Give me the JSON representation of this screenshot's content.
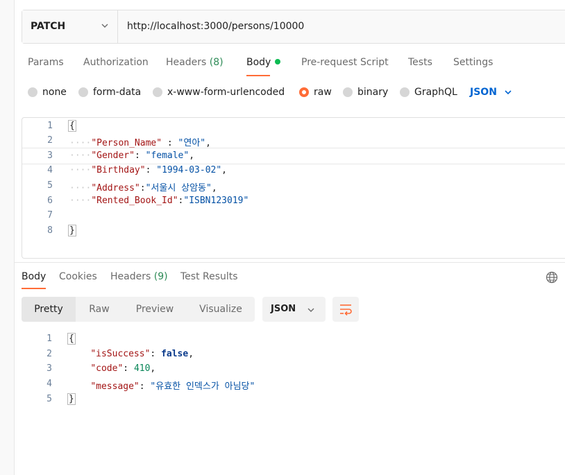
{
  "request": {
    "method": "PATCH",
    "url": "http://localhost:3000/persons/10000",
    "tabs": [
      {
        "label": "Params"
      },
      {
        "label": "Authorization"
      },
      {
        "label": "Headers",
        "count": "(8)"
      },
      {
        "label": "Body"
      },
      {
        "label": "Pre-request Script"
      },
      {
        "label": "Tests"
      },
      {
        "label": "Settings"
      }
    ],
    "body_types": [
      "none",
      "form-data",
      "x-www-form-urlencoded",
      "raw",
      "binary",
      "GraphQL"
    ],
    "selected_body_type": "raw",
    "format": "JSON",
    "line_numbers": [
      "1",
      "2",
      "3",
      "4",
      "5",
      "6",
      "7",
      "8"
    ],
    "body": {
      "open": "{",
      "close": "}",
      "fields": [
        {
          "key": "\"Person_Name\"",
          "sep": " : ",
          "value": "\"연아\"",
          "trail": ","
        },
        {
          "key": "\"Gender\"",
          "sep": ": ",
          "value": "\"female\"",
          "trail": ","
        },
        {
          "key": "\"Birthday\"",
          "sep": ": ",
          "value": "\"1994-03-02\"",
          "trail": ","
        },
        {
          "key": "\"Address\"",
          "sep": ":",
          "value": "\"서울시 상암동\"",
          "trail": ","
        },
        {
          "key": "\"Rented_Book_Id\"",
          "sep": ":",
          "value": "\"ISBN123019\"",
          "trail": ""
        }
      ]
    }
  },
  "response": {
    "tabs": [
      {
        "label": "Body"
      },
      {
        "label": "Cookies"
      },
      {
        "label": "Headers",
        "count": "(9)"
      },
      {
        "label": "Test Results"
      }
    ],
    "views": [
      "Pretty",
      "Raw",
      "Preview",
      "Visualize"
    ],
    "active_view": "Pretty",
    "format": "JSON",
    "line_numbers": [
      "1",
      "2",
      "3",
      "4",
      "5"
    ],
    "body": {
      "open": "{",
      "close": "}",
      "isSuccess_key": "\"isSuccess\"",
      "isSuccess_val": "false",
      "code_key": "\"code\"",
      "code_val": "410",
      "message_key": "\"message\"",
      "message_val": "\"유효한 인덱스가 아님당\""
    }
  },
  "colors": {
    "accent": "#ff6c37",
    "json_blue": "#0265d2",
    "active_dot": "#0cbb52"
  }
}
